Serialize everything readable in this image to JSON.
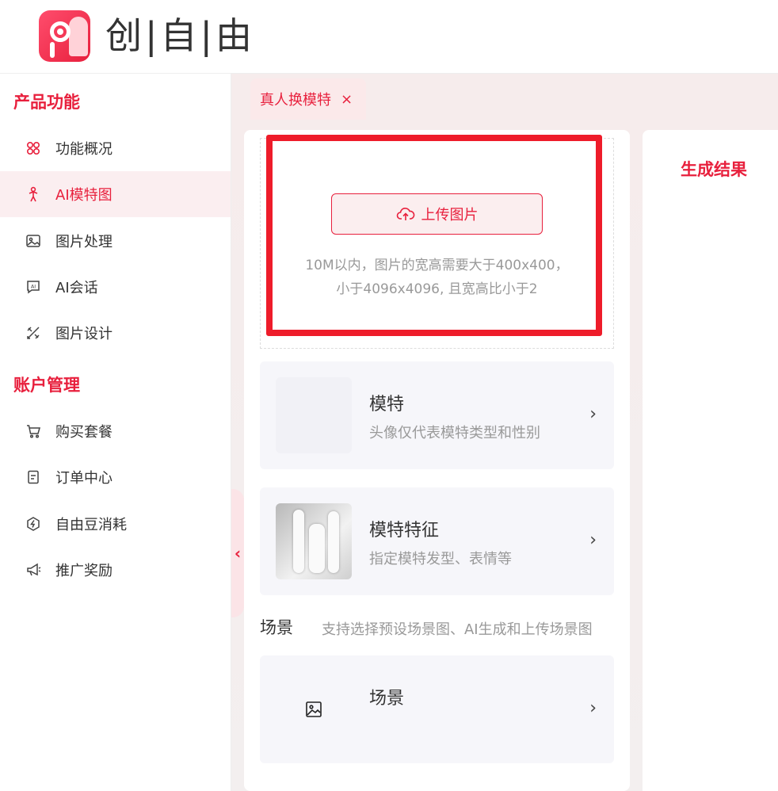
{
  "header": {
    "brand": "创|自|由"
  },
  "sidebar": {
    "section1_title": "产品功能",
    "section1_items": [
      {
        "label": "功能概况",
        "icon": "grid-icon"
      },
      {
        "label": "AI模特图",
        "icon": "person-icon"
      },
      {
        "label": "图片处理",
        "icon": "image-icon"
      },
      {
        "label": "AI会话",
        "icon": "chat-ai-icon"
      },
      {
        "label": "图片设计",
        "icon": "design-tools-icon"
      }
    ],
    "section2_title": "账户管理",
    "section2_items": [
      {
        "label": "购买套餐",
        "icon": "cart-icon"
      },
      {
        "label": "订单中心",
        "icon": "document-icon"
      },
      {
        "label": "自由豆消耗",
        "icon": "lightning-icon"
      },
      {
        "label": "推广奖励",
        "icon": "megaphone-icon"
      }
    ]
  },
  "tab": {
    "label": "真人换模特",
    "close": "×"
  },
  "upload": {
    "button_label": "上传图片",
    "hint_line1": "10M以内，图片的宽高需要大于400x400，",
    "hint_line2": "小于4096x4096, 且宽高比小于2"
  },
  "cards": [
    {
      "title": "模特",
      "subtitle": "头像仅代表模特类型和性别"
    },
    {
      "title": "模特特征",
      "subtitle": "指定模特发型、表情等"
    }
  ],
  "scene": {
    "label": "场景",
    "hint": "支持选择预设场景图、AI生成和上传场景图",
    "card_title": "场景"
  },
  "result": {
    "title": "生成结果"
  },
  "colors": {
    "accent": "#e8203d",
    "highlight": "#ee1c2a"
  }
}
